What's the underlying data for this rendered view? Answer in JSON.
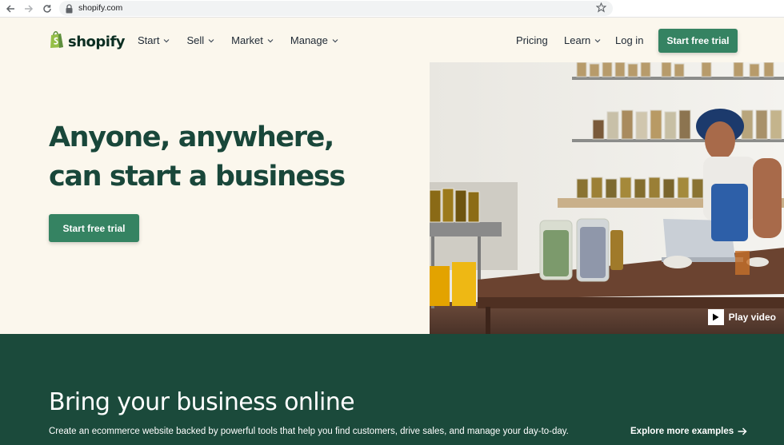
{
  "browser": {
    "url": "shopify.com"
  },
  "nav": {
    "logo_text": "shopify",
    "menu": [
      {
        "label": "Start"
      },
      {
        "label": "Sell"
      },
      {
        "label": "Market"
      },
      {
        "label": "Manage"
      }
    ],
    "pricing": "Pricing",
    "learn": "Learn",
    "login": "Log in",
    "cta": "Start free trial"
  },
  "hero": {
    "title_line1": "Anyone, anywhere,",
    "title_line2": "can start a business",
    "cta": "Start free trial",
    "play_label": "Play video"
  },
  "band": {
    "title": "Bring your business online",
    "subtitle": "Create an ecommerce website backed by powerful tools that help you find customers, drive sales, and manage your day-to-day.",
    "link": "Explore more examples"
  },
  "colors": {
    "brand_green": "#358362",
    "dark_green": "#1b4a3b",
    "heading_green": "#19473a",
    "cream": "#fbf7ed"
  }
}
